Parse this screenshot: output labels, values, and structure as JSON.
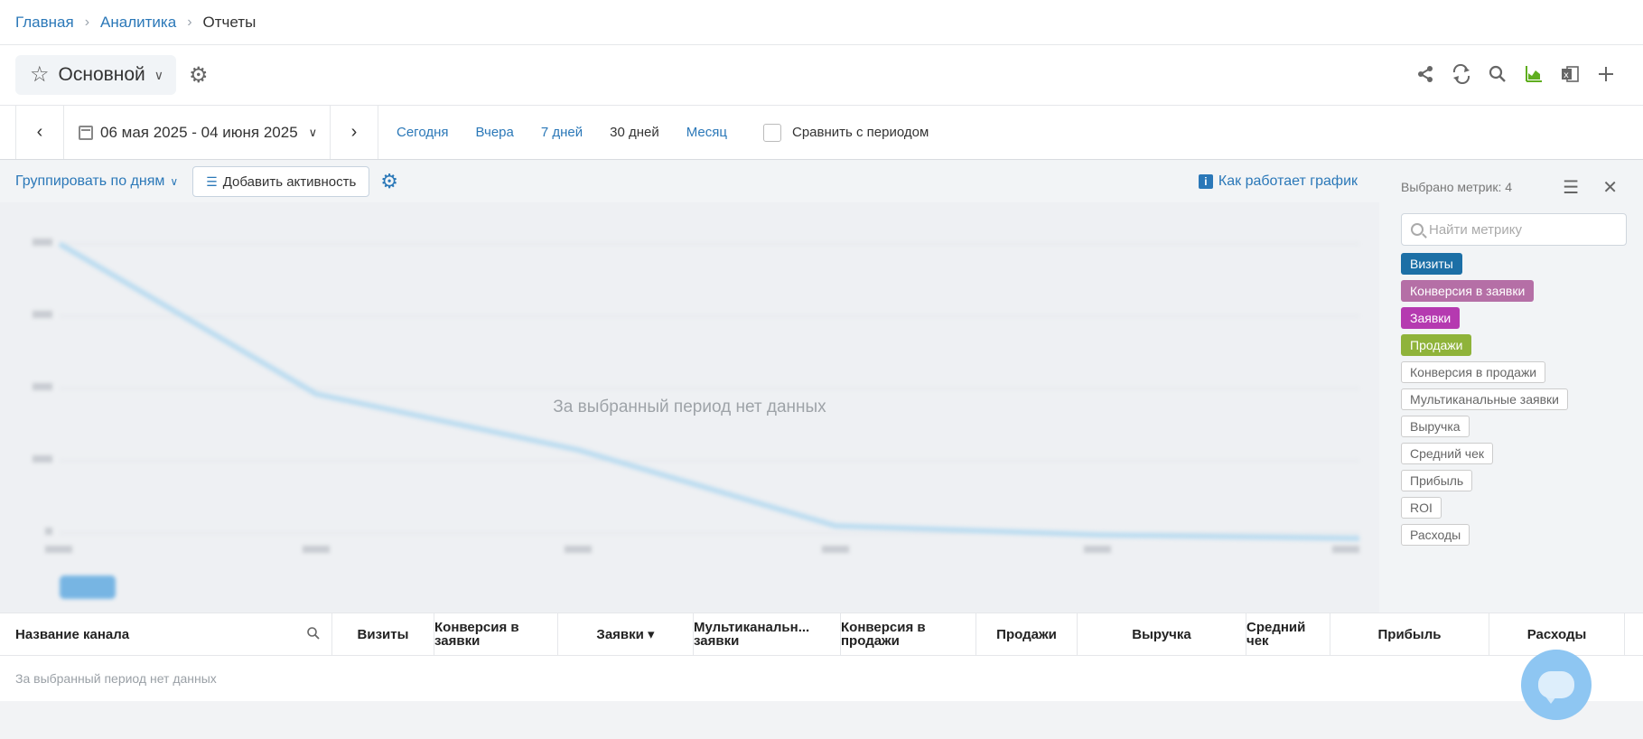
{
  "breadcrumb": {
    "items": [
      "Главная",
      "Аналитика"
    ],
    "current": "Отчеты"
  },
  "toolbar": {
    "report_name": "Основной",
    "icons": [
      "share-icon",
      "sync-icon",
      "search-icon",
      "chart-icon",
      "excel-icon",
      "plus-icon"
    ]
  },
  "datebar": {
    "range": "06 мая 2025 - 04 июня 2025",
    "presets": [
      "Сегодня",
      "Вчера",
      "7 дней",
      "30 дней",
      "Месяц"
    ],
    "active_preset": "30 дней",
    "compare_label": "Сравнить с периодом"
  },
  "chart_controls": {
    "group_by": "Группировать по дням",
    "add_activity": "Добавить активность",
    "how_it_works": "Как работает график"
  },
  "chart": {
    "no_data": "За выбранный период нет данных"
  },
  "metrics": {
    "selected_label": "Выбрано метрик: 4",
    "search_placeholder": "Найти метрику",
    "items": [
      {
        "label": "Визиты",
        "selected": true,
        "color": "#1c6fa6"
      },
      {
        "label": "Конверсия в заявки",
        "selected": true,
        "color": "#b56fa6"
      },
      {
        "label": "Заявки",
        "selected": true,
        "color": "#b53ab0"
      },
      {
        "label": "Продажи",
        "selected": true,
        "color": "#8fb33a"
      },
      {
        "label": "Конверсия в продажи",
        "selected": false
      },
      {
        "label": "Мультиканальные заявки",
        "selected": false
      },
      {
        "label": "Выручка",
        "selected": false
      },
      {
        "label": "Средний чек",
        "selected": false
      },
      {
        "label": "Прибыль",
        "selected": false
      },
      {
        "label": "ROI",
        "selected": false
      },
      {
        "label": "Расходы",
        "selected": false
      }
    ]
  },
  "table": {
    "first_column": "Название канала",
    "columns": [
      "Визиты",
      "Конверсия в заявки",
      "Заявки ▾",
      "Мультиканальн... заявки",
      "Конверсия в продажи",
      "Продажи",
      "Выручка",
      "Средний чек",
      "Прибыль",
      "Расходы"
    ],
    "no_data": "За выбранный период нет данных"
  }
}
